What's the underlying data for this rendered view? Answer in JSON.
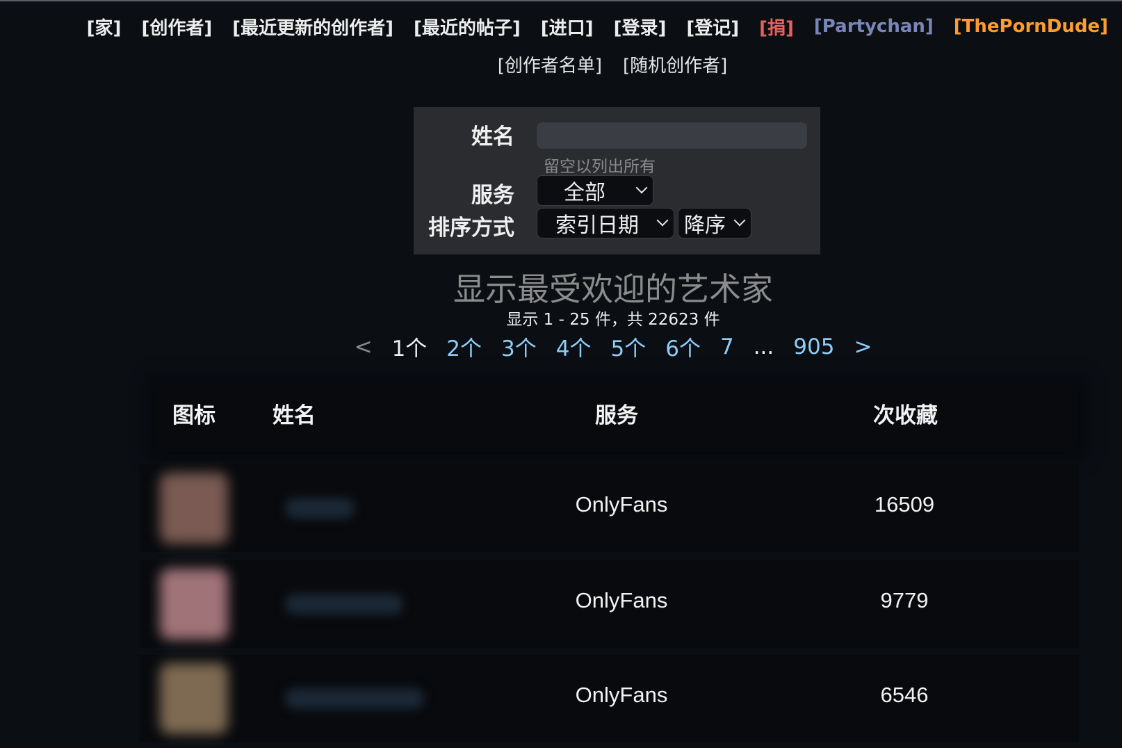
{
  "nav": {
    "primary": [
      {
        "label": "[家]",
        "kind": "normal"
      },
      {
        "label": "[创作者]",
        "kind": "normal"
      },
      {
        "label": "[最近更新的创作者]",
        "kind": "normal"
      },
      {
        "label": "[最近的帖子]",
        "kind": "normal"
      },
      {
        "label": "[进口]",
        "kind": "normal"
      },
      {
        "label": "[登录]",
        "kind": "normal"
      },
      {
        "label": "[登记]",
        "kind": "normal"
      },
      {
        "label": "[捐]",
        "kind": "donate"
      },
      {
        "label": "[Partychan]",
        "kind": "party"
      },
      {
        "label": "[ThePornDude]",
        "kind": "dude"
      }
    ],
    "secondary": [
      {
        "label": "[创作者名单]"
      },
      {
        "label": "[随机创作者]"
      }
    ]
  },
  "search": {
    "name_label": "姓名",
    "name_value": "",
    "name_hint": "留空以列出所有",
    "service_label": "服务",
    "service_selected": "全部",
    "sort_label": "排序方式",
    "sort_by_selected": "索引日期",
    "sort_order_selected": "降序"
  },
  "results": {
    "heading": "显示最受欢迎的艺术家",
    "showing": "显示 1 - 25 件，共 22623 件"
  },
  "pagination": {
    "prev": "<",
    "current": "1个",
    "pages": [
      "2个",
      "3个",
      "4个",
      "5个",
      "6个",
      "7"
    ],
    "ellipsis": "...",
    "last": "905",
    "next": ">"
  },
  "table": {
    "headers": {
      "icon": "图标",
      "name": "姓名",
      "service": "服务",
      "favorites": "次收藏"
    },
    "rows": [
      {
        "service": "OnlyFans",
        "favorites": "16509",
        "avatar_color": "#7a5a52"
      },
      {
        "service": "OnlyFans",
        "favorites": "9779",
        "avatar_color": "#a07378"
      },
      {
        "service": "OnlyFans",
        "favorites": "6546",
        "avatar_color": "#7e6a52"
      }
    ]
  },
  "colors": {
    "background": "#0b0f14",
    "donate": "#e9605b",
    "partychan": "#7a86b9",
    "porndude": "#ff9c2e",
    "page_link": "#8ecdf7"
  }
}
